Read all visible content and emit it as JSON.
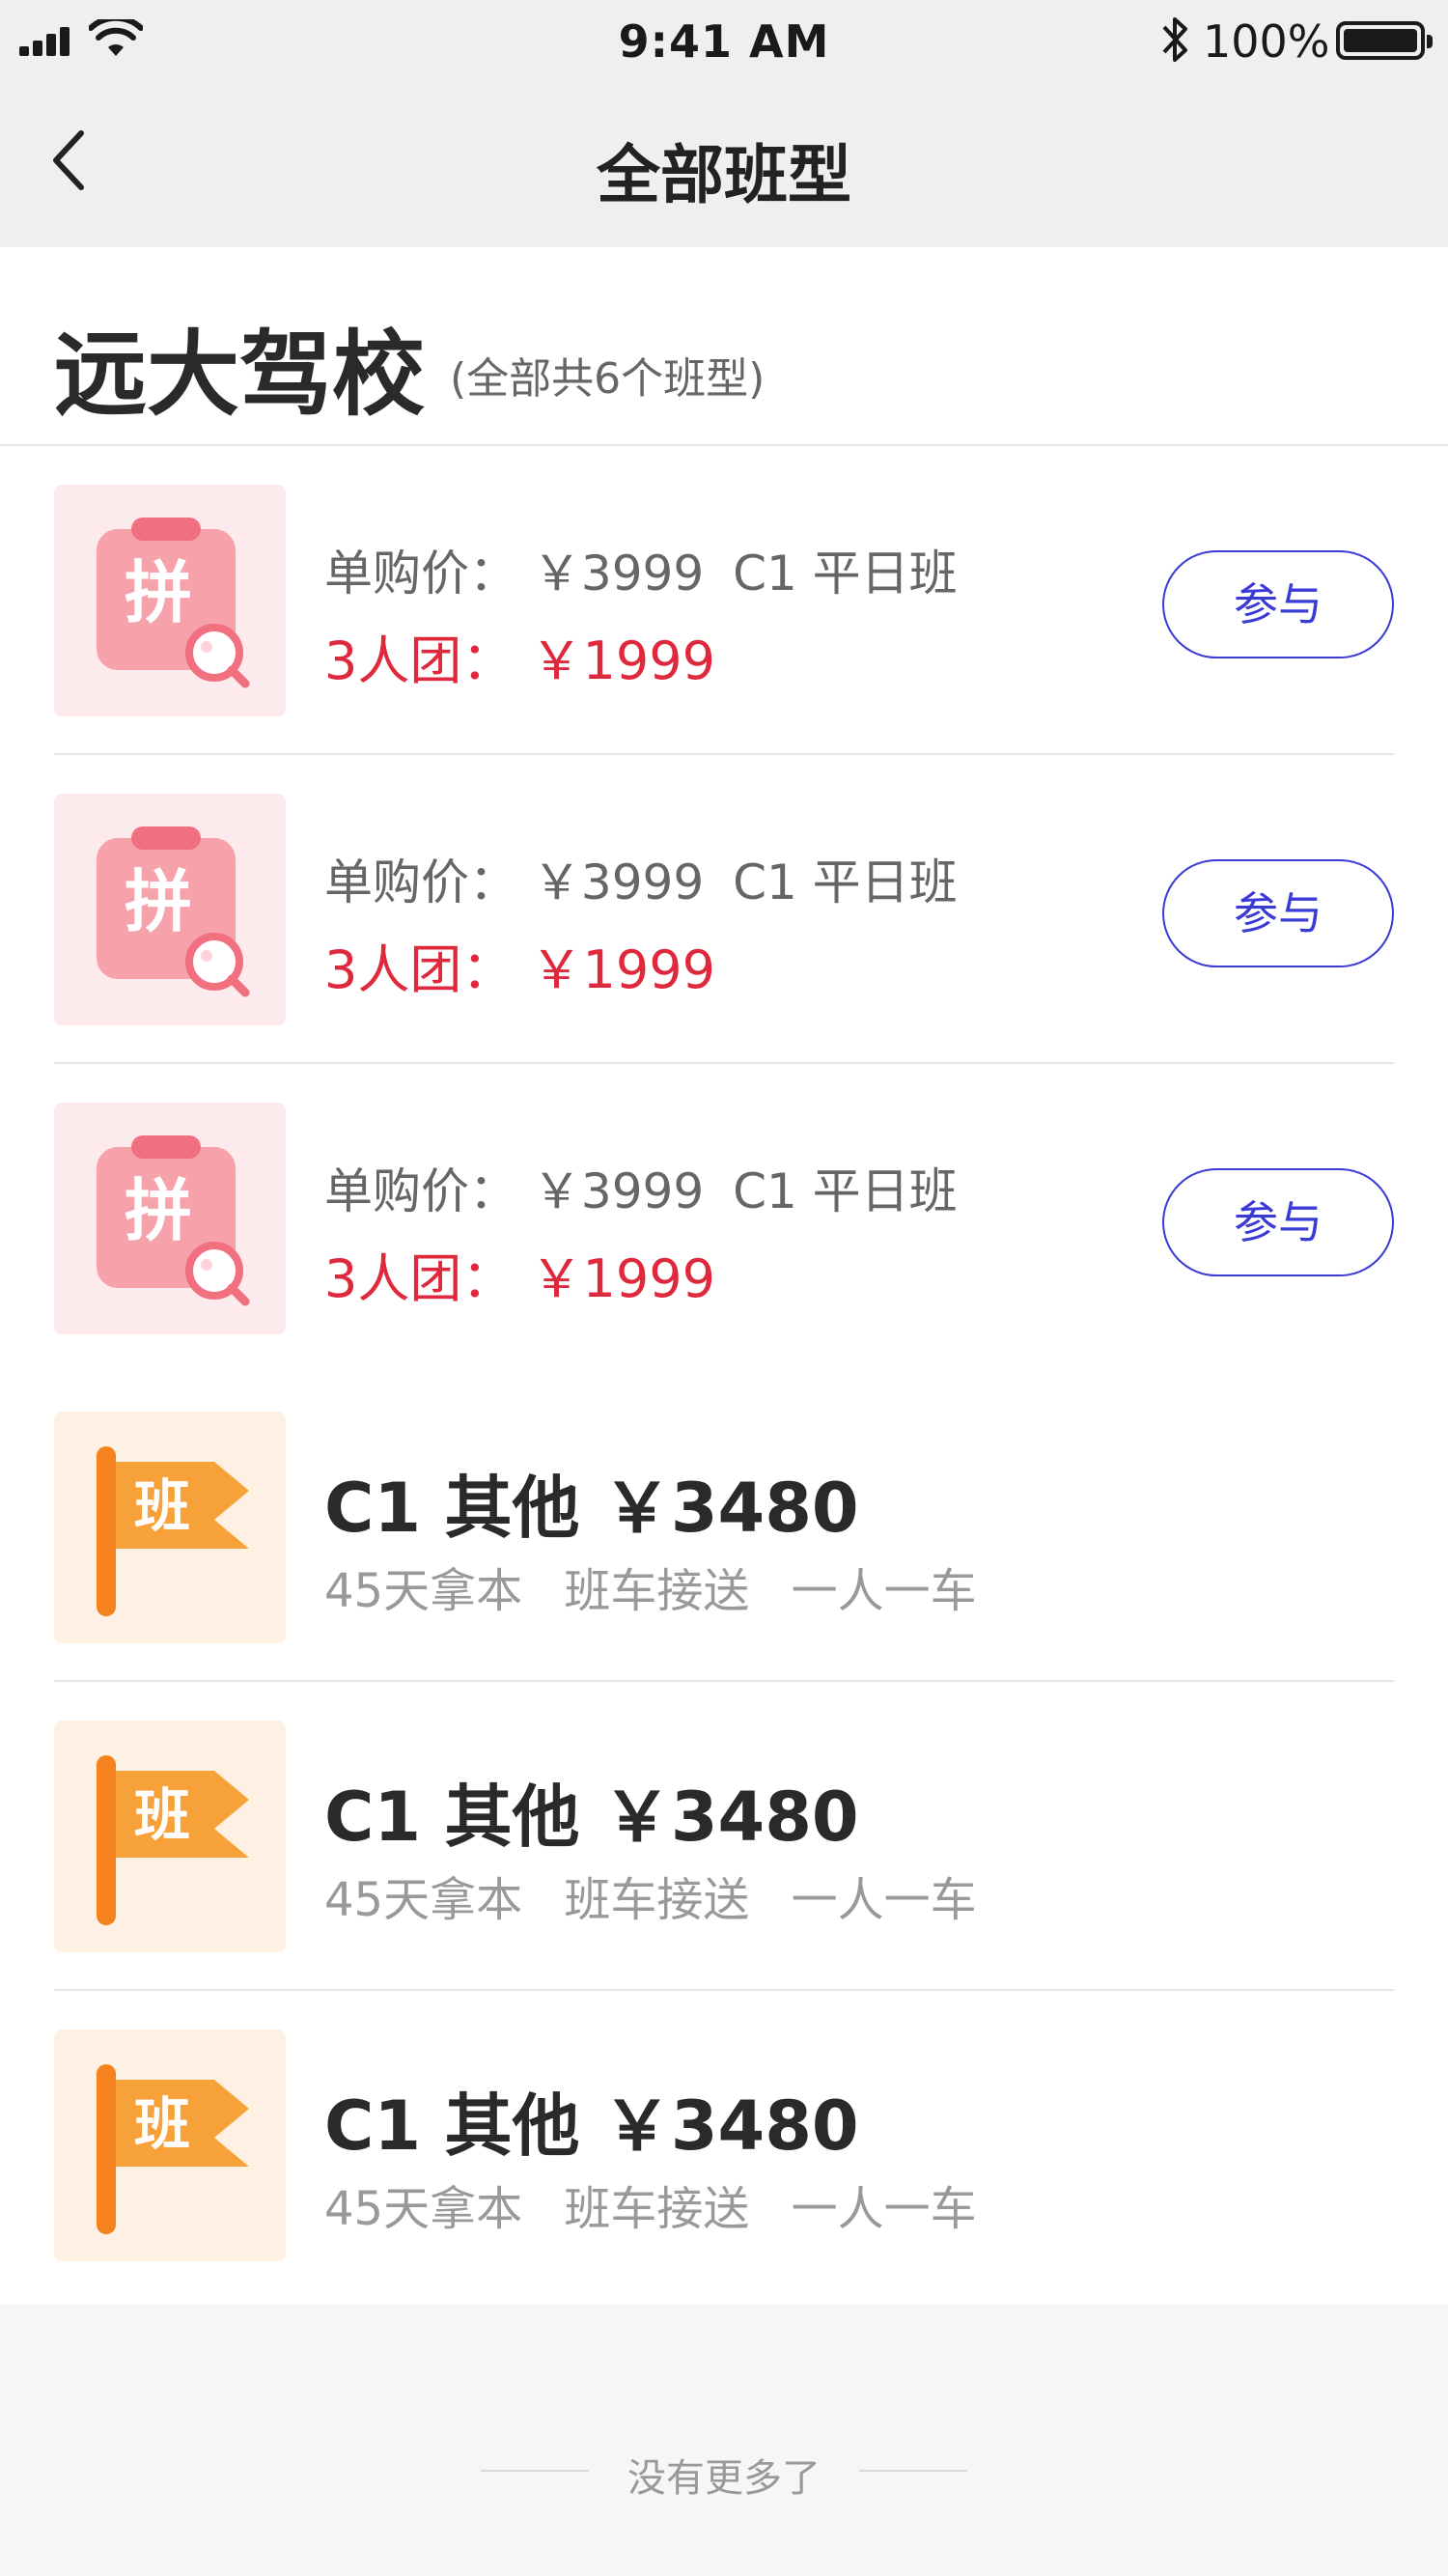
{
  "status_bar": {
    "time": "9:41 AM",
    "battery": "100%",
    "battery_level": 1.0
  },
  "navbar": {
    "title": "全部班型",
    "back_icon": "chevron-left-icon"
  },
  "school": {
    "name": "远大驾校",
    "count_text": "(全部共6个班型)"
  },
  "group_deals": [
    {
      "icon": "拼",
      "single_label": "单购价：",
      "single_price": "￥3999",
      "class_name": "C1 平日班",
      "group_label": "3人团：",
      "group_price": "￥1999",
      "button": "参与"
    },
    {
      "icon": "拼",
      "single_label": "单购价：",
      "single_price": "￥3999",
      "class_name": "C1 平日班",
      "group_label": "3人团：",
      "group_price": "￥1999",
      "button": "参与"
    },
    {
      "icon": "拼",
      "single_label": "单购价：",
      "single_price": "￥3999",
      "class_name": "C1 平日班",
      "group_label": "3人团：",
      "group_price": "￥1999",
      "button": "参与"
    }
  ],
  "classes": [
    {
      "icon": "班",
      "title": "C1 其他 ￥3480",
      "tags": [
        "45天拿本",
        "班车接送",
        "一人一车"
      ]
    },
    {
      "icon": "班",
      "title": "C1 其他 ￥3480",
      "tags": [
        "45天拿本",
        "班车接送",
        "一人一车"
      ]
    },
    {
      "icon": "班",
      "title": "C1 其他 ￥3480",
      "tags": [
        "45天拿本",
        "班车接送",
        "一人一车"
      ]
    }
  ],
  "footer": {
    "text": "没有更多了"
  },
  "colors": {
    "accent_blue": "#3a3ad6",
    "price_red": "#e0283c",
    "pin_bg": "#fdeaec",
    "pin_icon": "#f7a1ab",
    "ban_bg": "#fef0e3",
    "ban_icon": "#f7a13a",
    "ban_pole": "#f5821f"
  }
}
